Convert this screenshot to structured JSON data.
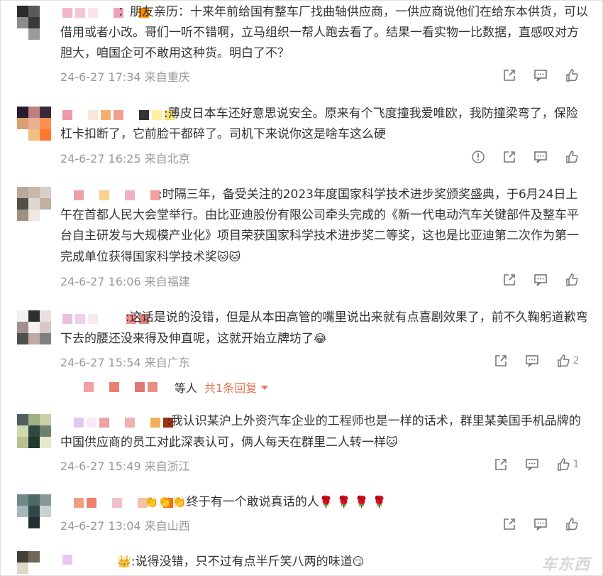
{
  "comments": [
    {
      "text": "：朋友亲历：十来年前给国有整车厂找曲轴供应商，一供应商说他们在给东本供货，可以借用或者小改。哥们一听不错啊，立马组织一帮人跑去看了。结果一看实物一比数据，直感叹对方胆大，咱国企可不敢用这种货。明白了不？",
      "meta": "24-6-27 17:34 来自重庆"
    },
    {
      "text": ":薄皮日本车还好意思说安全。原来有个飞度撞我爱唯欧，我防撞梁弯了，保险杠卡扣断了，它前脸干都碎了。司机下来说你这是啥车这么硬",
      "meta": "24-6-27 16:25 来自北京"
    },
    {
      "text": ":时隔三年，备受关注的2023年度国家科学技术进步奖颁奖盛典，于6月24日上午在首都人民大会堂举行。由比亚迪股份有限公司牵头完成的《新一代电动汽车关键部件及整车平台自主研发与大规模产业化》项目荣获国家科学技术进步奖二等奖，这也是比亚迪第二次作为第一完成单位获得国家科学技术奖",
      "emoji": "🐱🐱",
      "meta": "24-6-27 16:06 来自福建"
    },
    {
      "text": ":这话是说的没错，但是从本田高管的嘴里说出来就有点喜剧效果了，前不久鞠躬道歉弯下去的腰还没来得及伸直呢，这就开始立牌坊了",
      "emoji": "😂",
      "meta": "24-6-27 15:54 来自广东",
      "like_count": "2",
      "replies": {
        "who": "等人",
        "link": "共1条回复"
      }
    },
    {
      "text": ":我认识某沪上外资汽车企业的工程师也是一样的话术，群里某美国手机品牌的中国供应商的员工对此深表认可，俩人每天在群里二人转一样",
      "emoji": "🐱",
      "meta": "24-6-27 15:49 来自浙江",
      "like_count": "1"
    },
    {
      "prefix_emoji": "👏👏👏",
      "text": "终于有一个敢说真话的人",
      "emoji": "🌹 🌹 🌹 🌹",
      "meta": "24-6-27 13:04 来自山西"
    },
    {
      "prefix_emoji": "👑",
      "text": ":说得没错，只不过有点半斤笑八两的味道",
      "emoji": "😏"
    }
  ],
  "icons": {
    "share": "share-icon",
    "comment": "comment-icon",
    "like": "like-icon",
    "report": "report-icon"
  },
  "colors": {
    "link": "#eb7350",
    "meta": "#999999",
    "text": "#333333"
  },
  "watermark": "车东西"
}
